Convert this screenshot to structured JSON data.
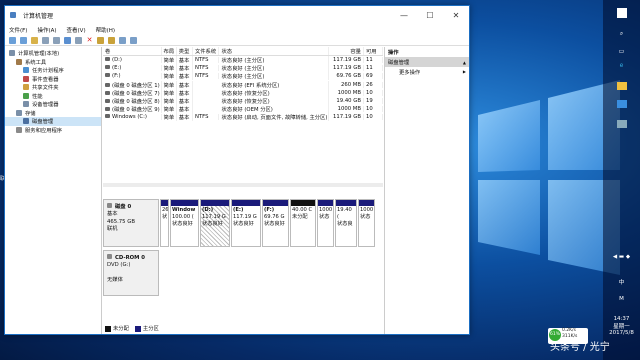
{
  "window": {
    "title": "计算机管理",
    "minimize": "—",
    "maximize": "☐",
    "close": "✕"
  },
  "menu": [
    "文件(F)",
    "操作(A)",
    "查看(V)",
    "帮助(H)"
  ],
  "tree": [
    {
      "label": "计算机管理(本地)",
      "indent": 0,
      "selected": false
    },
    {
      "label": "系统工具",
      "indent": 1,
      "selected": false
    },
    {
      "label": "任务计划程序",
      "indent": 2,
      "selected": false
    },
    {
      "label": "事件查看器",
      "indent": 2,
      "selected": false
    },
    {
      "label": "共享文件夹",
      "indent": 2,
      "selected": false
    },
    {
      "label": "性能",
      "indent": 2,
      "selected": false
    },
    {
      "label": "设备管理器",
      "indent": 2,
      "selected": false
    },
    {
      "label": "存储",
      "indent": 1,
      "selected": false
    },
    {
      "label": "磁盘管理",
      "indent": 2,
      "selected": true
    },
    {
      "label": "服务和应用程序",
      "indent": 1,
      "selected": false
    }
  ],
  "volume_headers": [
    "卷",
    "布局",
    "类型",
    "文件系统",
    "状态",
    "容量",
    "可用"
  ],
  "volumes": [
    [
      "(D:)",
      "简单",
      "基本",
      "NTFS",
      "状态良好 (主分区)",
      "117.19 GB",
      "11"
    ],
    [
      "(E:)",
      "简单",
      "基本",
      "NTFS",
      "状态良好 (主分区)",
      "117.19 GB",
      "11"
    ],
    [
      "(F:)",
      "简单",
      "基本",
      "NTFS",
      "状态良好 (主分区)",
      "69.76 GB",
      "69"
    ],
    [
      "(磁盘 0 磁盘分区 1)",
      "简单",
      "基本",
      "",
      "状态良好 (EFI 系统分区)",
      "260 MB",
      "26"
    ],
    [
      "(磁盘 0 磁盘分区 7)",
      "简单",
      "基本",
      "",
      "状态良好 (恢复分区)",
      "1000 MB",
      "10"
    ],
    [
      "(磁盘 0 磁盘分区 8)",
      "简单",
      "基本",
      "",
      "状态良好 (恢复分区)",
      "19.40 GB",
      "19"
    ],
    [
      "(磁盘 0 磁盘分区 9)",
      "简单",
      "基本",
      "",
      "状态良好 (OEM 分区)",
      "1000 MB",
      "10"
    ],
    [
      "Windows (C:)",
      "简单",
      "基本",
      "NTFS",
      "状态良好 (启动, 页面文件, 故障转储, 主分区)",
      "117.19 GB",
      "10"
    ]
  ],
  "disk0": {
    "name": "磁盘 0",
    "type": "基本",
    "size": "465.75 GB",
    "status": "联机",
    "partitions": [
      {
        "name": "",
        "size": "26",
        "status": "状",
        "color": "#1a1a7a",
        "width": 9
      },
      {
        "name": "Window",
        "size": "100.00 (",
        "status": "状态良好",
        "color": "#1a1a7a",
        "width": 29
      },
      {
        "name": "(D:)",
        "size": "117.19 G",
        "status": "状态良好",
        "color": "#1a1a7a",
        "width": 30,
        "hatched": true
      },
      {
        "name": "(E:)",
        "size": "117.19 G",
        "status": "状态良好",
        "color": "#1a1a7a",
        "width": 30
      },
      {
        "name": "(F:)",
        "size": "69.76 G",
        "status": "状态良好",
        "color": "#1a1a7a",
        "width": 27
      },
      {
        "name": "",
        "size": "40.00 C",
        "status": "未分配",
        "color": "#111",
        "width": 26
      },
      {
        "name": "",
        "size": "1000",
        "status": "状态",
        "color": "#1a1a7a",
        "width": 17
      },
      {
        "name": "",
        "size": "19.40 (",
        "status": "状态良",
        "color": "#1a1a7a",
        "width": 22
      },
      {
        "name": "",
        "size": "1000",
        "status": "状态",
        "color": "#1a1a7a",
        "width": 17
      }
    ]
  },
  "cdrom": {
    "name": "CD-ROM 0",
    "type": "DVD (G:)",
    "media": "无媒体"
  },
  "legend": [
    {
      "label": "未分配",
      "color": "#111"
    },
    {
      "label": "主分区",
      "color": "#1a1a7a"
    }
  ],
  "actions": {
    "header": "操作",
    "section": "磁盘管理",
    "section_arrow": "▲",
    "item": "更多操作",
    "item_arrow": "▶"
  },
  "taskbar": {
    "time": "14:37",
    "day": "星期一",
    "date": "2017/5/8",
    "ime": "中",
    "ime2": "M"
  },
  "network": {
    "percent": "61%",
    "up": "0.2K/s",
    "down": "311K/s"
  },
  "watermark": "头条号 / 光宁",
  "left_edge": "联"
}
